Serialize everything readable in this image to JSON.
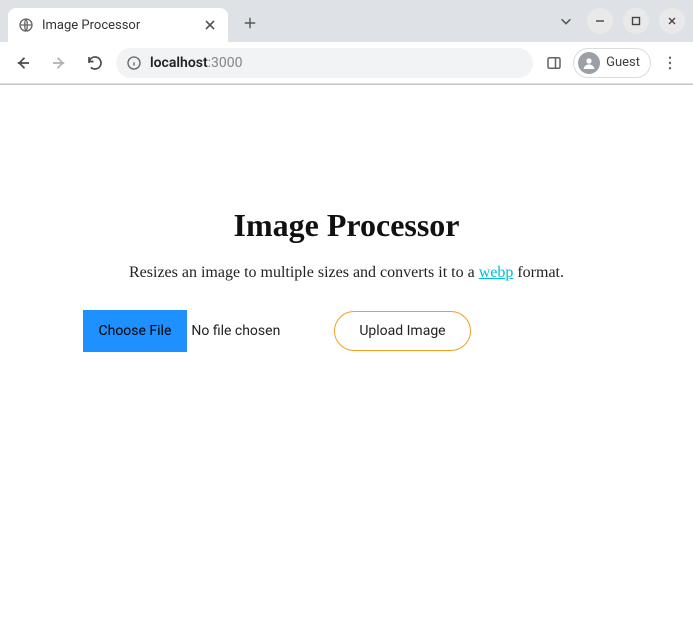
{
  "browser": {
    "tab": {
      "title": "Image Processor"
    },
    "url": {
      "host": "localhost",
      "port": ":3000"
    },
    "profile_label": "Guest"
  },
  "page": {
    "heading": "Image Processor",
    "description_prefix": "Resizes an image to multiple sizes and converts it to a ",
    "description_link": "webp",
    "description_suffix": " format.",
    "choose_file_label": "Choose File",
    "file_status": "No file chosen",
    "upload_label": "Upload Image"
  }
}
